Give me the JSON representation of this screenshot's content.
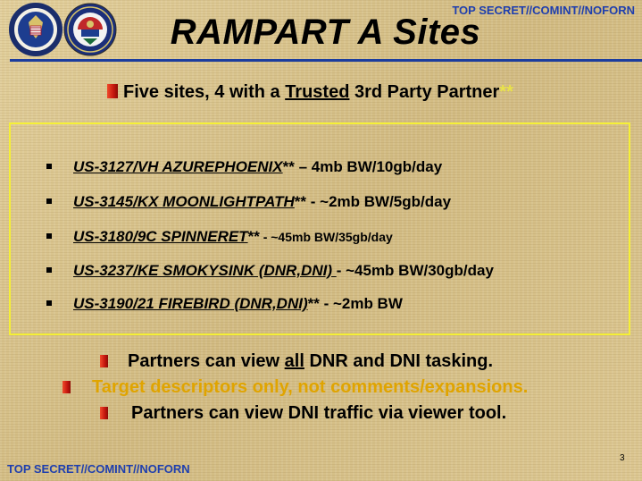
{
  "classification": "TOP SECRET//COMINT//NOFORN",
  "title": "RAMPART A Sites",
  "subtitle": {
    "pre": "Five sites, 4 with a ",
    "underlined": "Trusted",
    "post": " 3rd Party Partner",
    "asterisks": "**"
  },
  "sites": [
    {
      "name": "US-3127/VH AZUREPHOENIX",
      "asterisks": "**",
      "bandwidth": " – 4mb BW/10gb/day"
    },
    {
      "name": "US-3145/KX MOONLIGHTPATH",
      "asterisks": "**",
      "bandwidth": " - ~2mb BW/5gb/day"
    },
    {
      "name": "US-3180/9C SPINNERET",
      "asterisks": "**",
      "bandwidth": " - ~45mb BW/35gb/day"
    },
    {
      "name": "US-3237/KE SMOKYSINK (DNR,DNI) ",
      "asterisks": "",
      "bandwidth": "- ~45mb BW/30gb/day"
    },
    {
      "name": "US-3190/21 FIREBIRD (DNR,DNI)",
      "asterisks": "**",
      "bandwidth": "  - ~2mb BW"
    }
  ],
  "bullets": [
    {
      "pre": "Partners can view ",
      "underlined": "all",
      "post": " DNR and DNI tasking."
    },
    {
      "text": "Target descriptors only, not comments/expansions."
    },
    {
      "text": "Partners can view DNI traffic via viewer tool."
    }
  ],
  "page_number": "3",
  "logos": [
    "nsa-seal-icon",
    "central-security-service-seal-icon"
  ],
  "colors": {
    "classification": "#1f3fae",
    "rule": "#1c3d9e",
    "box_border": "#f5f036",
    "bullet_red": "#c4160e",
    "highlight_text": "#e0a400"
  }
}
